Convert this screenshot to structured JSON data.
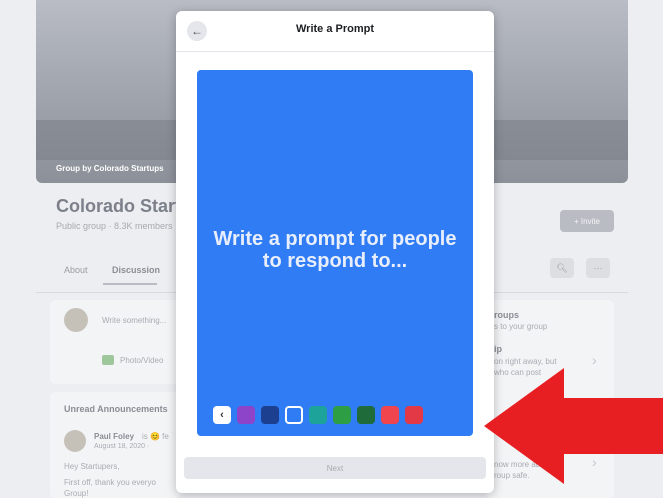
{
  "background": {
    "cover_label": "Group by Colorado Startups",
    "group_title": "Colorado Startups",
    "group_meta": "Public group · 8.3K members",
    "invite_label": "+ Invite",
    "tabs": [
      {
        "label": "About"
      },
      {
        "label": "Discussion"
      }
    ],
    "composer_placeholder": "Write something...",
    "photo_video_label": "Photo/Video",
    "announcements_heading": "Unread Announcements",
    "post": {
      "author": "Paul Foley",
      "author_suffix": "is 😊 fe",
      "date": "August 18, 2020 ·",
      "greeting": "Hey Startupers,",
      "body_line1": "First off, thank you everyo",
      "body_line2": "Group!"
    },
    "right_card": {
      "line1": "roups",
      "line2": "s to your group",
      "line3": "ip",
      "line4": "on right away, but",
      "line5": "who can post",
      "line6": "now more ab",
      "line7": "roup safe."
    }
  },
  "modal": {
    "title": "Write a Prompt",
    "prompt_text": "Write a prompt for people to respond to...",
    "canvas_color": "#2f7cf4",
    "back_icon": "←",
    "swatch_back_icon": "‹",
    "swatches": [
      {
        "name": "purple",
        "color": "#8e44c9"
      },
      {
        "name": "navy",
        "color": "#1d3f8f"
      },
      {
        "name": "blue",
        "color": "#2f7cf4",
        "selected": true
      },
      {
        "name": "teal",
        "color": "#1ea39a"
      },
      {
        "name": "green",
        "color": "#2e9e45"
      },
      {
        "name": "dark-green",
        "color": "#1f6b3a"
      },
      {
        "name": "coral",
        "color": "#f0454f"
      },
      {
        "name": "red",
        "color": "#e33845"
      }
    ],
    "next_label": "Next"
  },
  "annotation_arrow_color": "#e81f22"
}
